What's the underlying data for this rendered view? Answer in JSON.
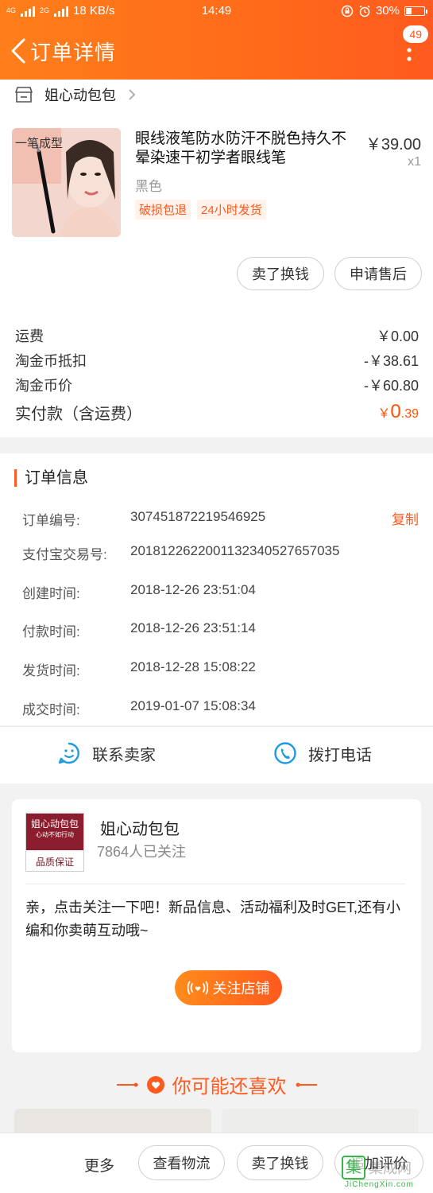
{
  "status_bar": {
    "network": "4G",
    "network2": "2G",
    "speed": "18 KB/s",
    "time": "14:49",
    "battery": "30%"
  },
  "nav": {
    "title": "订单详情",
    "badge": "49"
  },
  "shop": {
    "name": "姐心动包包"
  },
  "product": {
    "image_text": "一笔成型",
    "title": "眼线液笔防水防汗不脱色持久不晕染速干初学者眼线笔",
    "price": "￥39.00",
    "qty": "x1",
    "sku": "黑色",
    "tags": [
      "破损包退",
      "24小时发货"
    ]
  },
  "actions": {
    "sell_swap": "卖了换钱",
    "after_sale": "申请售后"
  },
  "fees": [
    {
      "label": "运费",
      "value": "￥0.00"
    },
    {
      "label": "淘金币抵扣",
      "value": "-￥38.61"
    },
    {
      "label": "淘金币价",
      "value": "-￥60.80"
    }
  ],
  "total": {
    "label": "实付款（含运费）",
    "currency": "￥",
    "int": "0",
    "dec": ".39"
  },
  "order_info": {
    "title": "订单信息",
    "copy": "复制",
    "rows": [
      {
        "label": "订单编号:",
        "value": "307451872219546925"
      },
      {
        "label": "支付宝交易号:",
        "value": "2018122622001132340527657035"
      },
      {
        "label": "创建时间:",
        "value": "2018-12-26 23:51:04"
      },
      {
        "label": "付款时间:",
        "value": "2018-12-26 23:51:14"
      },
      {
        "label": "发货时间:",
        "value": "2018-12-28 15:08:22"
      },
      {
        "label": "成交时间:",
        "value": "2019-01-07 15:08:34"
      }
    ]
  },
  "contact": {
    "seller": "联系卖家",
    "phone": "拨打电话"
  },
  "shop_card": {
    "logo_text": "姐心动包包",
    "logo_sub": "心动不如行动",
    "logo_seal": "品质保证",
    "name": "姐心动包包",
    "followers": "7864人已关注",
    "message": "亲，点击关注一下吧！新品信息、活动福利及时GET,还有小编和你卖萌互动哦~",
    "follow_btn": "关注店铺"
  },
  "guess": {
    "title": "你可能还喜欢"
  },
  "bottom_bar": {
    "more": "更多",
    "logistics": "查看物流",
    "sell_swap": "卖了换钱",
    "review": "追加评价"
  },
  "watermark": {
    "brand": "集成网",
    "url": "JiChengXin.com"
  },
  "colors": {
    "accent": "#ff5a1f",
    "header": "#ff7e1b"
  }
}
